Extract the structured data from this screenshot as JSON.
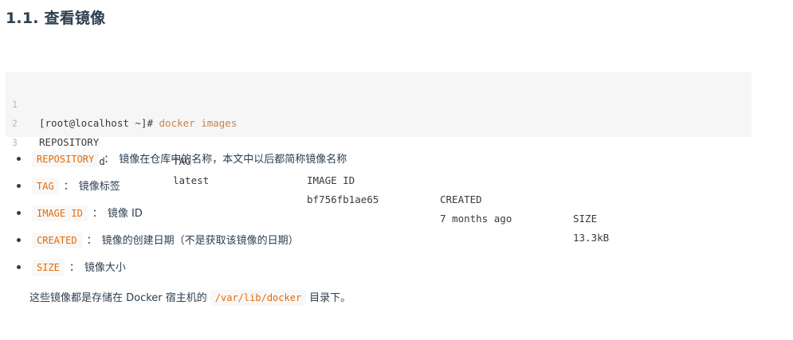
{
  "heading": "1.1. 查看镜像",
  "code": {
    "line_numbers": [
      "1",
      "2",
      "3"
    ],
    "prompt": "[root@localhost ~]# ",
    "command": "docker images",
    "headers": [
      "REPOSITORY",
      "TAG",
      "IMAGE ID",
      "CREATED",
      "SIZE"
    ],
    "row": [
      "hello-world",
      "latest",
      "bf756fb1ae65",
      "7 months ago",
      "13.3kB"
    ]
  },
  "bullets": [
    {
      "term": "REPOSITORY",
      "sep": "：",
      "desc": "镜像在仓库中的名称，本文中以后都简称镜像名称"
    },
    {
      "term": "TAG",
      "sep": "：",
      "desc": "镜像标签"
    },
    {
      "term": "IMAGE ID",
      "sep": "：",
      "desc": "镜像 ID"
    },
    {
      "term": "CREATED",
      "sep": "：",
      "desc": "镜像的创建日期（不是获取该镜像的日期）"
    },
    {
      "term": "SIZE",
      "sep": "：",
      "desc": "镜像大小"
    }
  ],
  "paragraph": {
    "before": "这些镜像都是存储在 Docker 宿主机的",
    "code": "/var/lib/docker",
    "after": "目录下。"
  }
}
